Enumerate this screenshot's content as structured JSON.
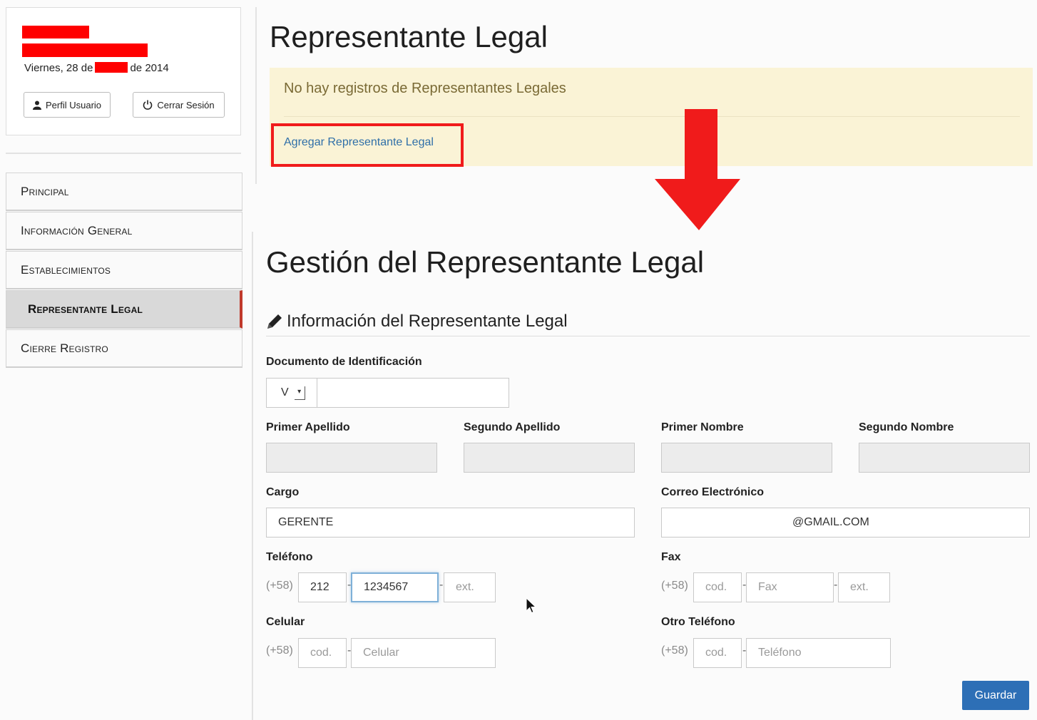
{
  "sidebar": {
    "date_prefix": "Viernes, 28 de",
    "date_suffix": "de 2014",
    "profile_button": "Perfil Usuario",
    "logout_button": "Cerrar Sesión",
    "nav": [
      {
        "label": "Principal"
      },
      {
        "label": "Información General"
      },
      {
        "label": "Establecimientos"
      },
      {
        "label": "Representante Legal"
      },
      {
        "label": "Cierre Registro"
      }
    ]
  },
  "top_panel": {
    "title": "Representante Legal",
    "alert_text": "No hay registros de Representantes Legales",
    "add_link": "Agregar Representante Legal"
  },
  "form": {
    "title": "Gestión del Representante Legal",
    "section_title": "Información del Representante Legal",
    "document": {
      "label": "Documento de Identificación",
      "type_value": "V",
      "number_value": ""
    },
    "primer_apellido": {
      "label": "Primer Apellido",
      "value": ""
    },
    "segundo_apellido": {
      "label": "Segundo Apellido",
      "value": ""
    },
    "primer_nombre": {
      "label": "Primer Nombre",
      "value": ""
    },
    "segundo_nombre": {
      "label": "Segundo Nombre",
      "value": ""
    },
    "cargo": {
      "label": "Cargo",
      "value": "GERENTE"
    },
    "correo": {
      "label": "Correo Electrónico",
      "value": "@GMAIL.COM"
    },
    "telefono": {
      "label": "Teléfono",
      "prefix": "(+58)",
      "cod_value": "212",
      "number_value": "1234567",
      "ext_placeholder": "ext."
    },
    "fax": {
      "label": "Fax",
      "prefix": "(+58)",
      "cod_placeholder": "cod.",
      "number_placeholder": "Fax",
      "ext_placeholder": "ext."
    },
    "celular": {
      "label": "Celular",
      "prefix": "(+58)",
      "cod_placeholder": "cod.",
      "number_placeholder": "Celular"
    },
    "otro_telefono": {
      "label": "Otro Teléfono",
      "prefix": "(+58)",
      "cod_placeholder": "cod.",
      "number_placeholder": "Teléfono"
    },
    "save_button": "Guardar"
  },
  "colors": {
    "annotation_red": "#f01b1b",
    "primary_blue": "#2d6fb6",
    "alert_bg": "#faf3d6"
  }
}
